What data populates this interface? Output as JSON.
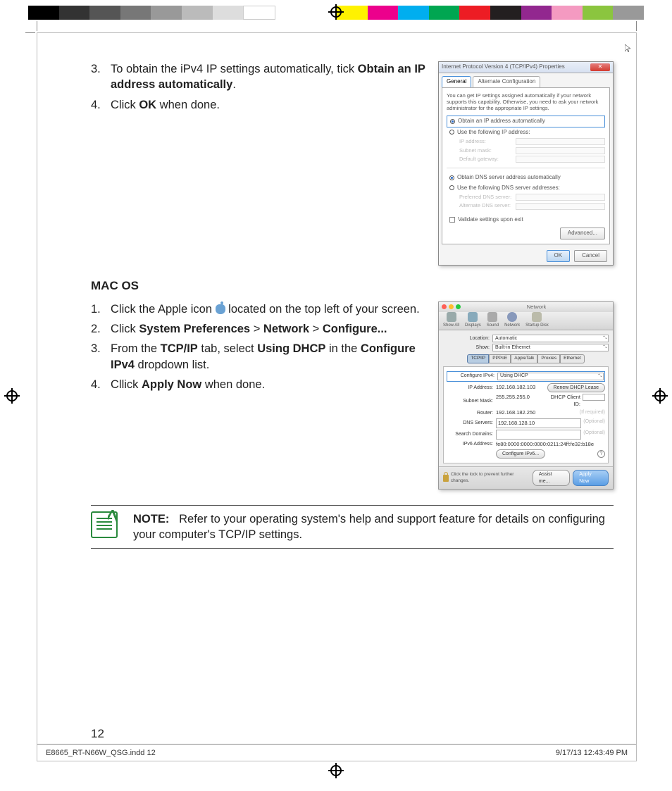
{
  "colorbar": [
    "#000",
    "#333",
    "#555",
    "#777",
    "#999",
    "#bbb",
    "#ddd",
    "#fff",
    "",
    "",
    "#fff200",
    "#ec008c",
    "#00aeef",
    "#00a651",
    "#ed1c24",
    "#231f20",
    "#f7941d",
    "#d6b4dd",
    "#8bc53f",
    "#999"
  ],
  "steps_win": [
    {
      "num": "3.",
      "pre": "To obtain the iPv4 IP settings automatically, tick ",
      "bold": "Obtain an IP address automatically",
      "post": "."
    },
    {
      "num": "4.",
      "pre": "Click ",
      "bold": "OK",
      "post": " when done."
    }
  ],
  "macos_heading": "MAC OS",
  "steps_mac": [
    {
      "num": "1.",
      "parts": [
        "Click the Apple icon ",
        "@apple",
        " located on the top left of your screen."
      ]
    },
    {
      "num": "2.",
      "parts": [
        "Click ",
        "[b]System Preferences",
        "[t] > ",
        "[b]Network",
        "[t] > ",
        "[b]Configure..."
      ]
    },
    {
      "num": "3.",
      "parts": [
        "From the ",
        "[b]TCP/IP",
        "[t] tab, select ",
        "[b]Using DHCP",
        "[t] in the ",
        "[b]Configure IPv4",
        "[t] dropdown list."
      ]
    },
    {
      "num": "4.",
      "parts": [
        "Cllick ",
        "[b]Apply Now",
        "[t] when done."
      ]
    }
  ],
  "note_label": "NOTE:",
  "note_text": "Refer to your operating system's help and support feature for details on configuring your computer's TCP/IP settings.",
  "page_number": "12",
  "footer_left": "E8665_RT-N66W_QSG.indd   12",
  "footer_right": "9/17/13   12:43:49 PM",
  "win": {
    "title": "Internet Protocol Version 4 (TCP/IPv4) Properties",
    "tabs": [
      "General",
      "Alternate Configuration"
    ],
    "desc": "You can get IP settings assigned automatically if your network supports this capability. Otherwise, you need to ask your network administrator for the appropriate IP settings.",
    "r1": "Obtain an IP address automatically",
    "r2": "Use the following IP address:",
    "f_ip": "IP address:",
    "f_sub": "Subnet mask:",
    "f_gw": "Default gateway:",
    "r3": "Obtain DNS server address automatically",
    "r4": "Use the following DNS server addresses:",
    "f_pdns": "Preferred DNS server:",
    "f_adns": "Alternate DNS server:",
    "chk": "Validate settings upon exit",
    "adv": "Advanced...",
    "ok": "OK",
    "cancel": "Cancel"
  },
  "mac": {
    "title": "Network",
    "tb": [
      "Show All",
      "Displays",
      "Sound",
      "Network",
      "Startup Disk"
    ],
    "loc_l": "Location:",
    "loc_v": "Automatic",
    "show_l": "Show:",
    "show_v": "Built-in Ethernet",
    "subtabs": [
      "TCP/IP",
      "PPPoE",
      "AppleTalk",
      "Proxies",
      "Ethernet"
    ],
    "cfg_l": "Configure IPv4:",
    "cfg_v": "Using DHCP",
    "ip_l": "IP Address:",
    "ip_v": "192.168.182.103",
    "renew": "Renew DHCP Lease",
    "sub_l": "Subnet Mask:",
    "sub_v": "255.255.255.0",
    "cid_l": "DHCP Client ID:",
    "rt_l": "Router:",
    "rt_v": "192.168.182.250",
    "req": "(If required)",
    "dns_l": "DNS Servers:",
    "dns_v": "192.168.128.10",
    "sd_l": "Search Domains:",
    "opt": "(Optional)",
    "v6_l": "IPv6 Address:",
    "v6_v": "fe80:0000:0000:0000:0211:24ff:fe32:b18e",
    "cfgv6": "Configure IPv6...",
    "lock": "Click the lock to prevent further changes.",
    "assist": "Assist me...",
    "apply": "Apply Now"
  }
}
